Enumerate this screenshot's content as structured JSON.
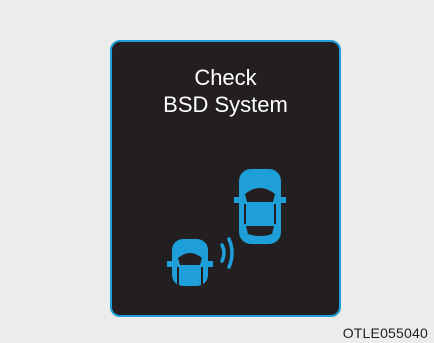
{
  "warning": {
    "line1": "Check",
    "line2": "BSD System"
  },
  "figure_code": "OTLE055040",
  "icons": [
    "car-icon",
    "rear-car-icon",
    "radar-wave-icon"
  ],
  "colors": {
    "background": "#ececec",
    "panel": "#231f20",
    "accent": "#1f9fd9",
    "text": "#ffffff"
  }
}
